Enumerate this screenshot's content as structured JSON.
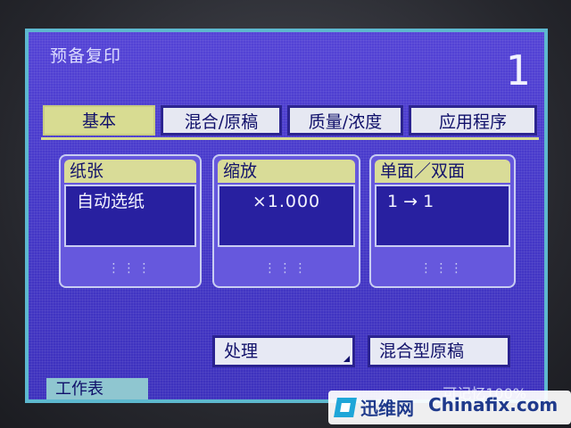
{
  "screen": {
    "title": "预备复印",
    "copy_count": "1"
  },
  "tabs": [
    {
      "label": "基本",
      "active": true
    },
    {
      "label": "混合/原稿",
      "active": false
    },
    {
      "label": "质量/浓度",
      "active": false
    },
    {
      "label": "应用程序",
      "active": false
    }
  ],
  "panels": {
    "paper": {
      "label": "纸张",
      "value": "自动选纸"
    },
    "zoom": {
      "label": "缩放",
      "value": "×1.000"
    },
    "duplex": {
      "label": "单面／双面",
      "value": "1 → 1"
    }
  },
  "actions": {
    "process": "处理",
    "mixed_original": "混合型原稿"
  },
  "footer": {
    "job_list": "工作表",
    "memory": "可记忆100%"
  },
  "watermark": {
    "cn": "迅维网",
    "en": "Chinafix.com"
  },
  "colors": {
    "screen_bg": "#4639cc",
    "label_bg": "#d9dc98",
    "value_bg": "#2820a0",
    "border": "#5db8cf"
  }
}
